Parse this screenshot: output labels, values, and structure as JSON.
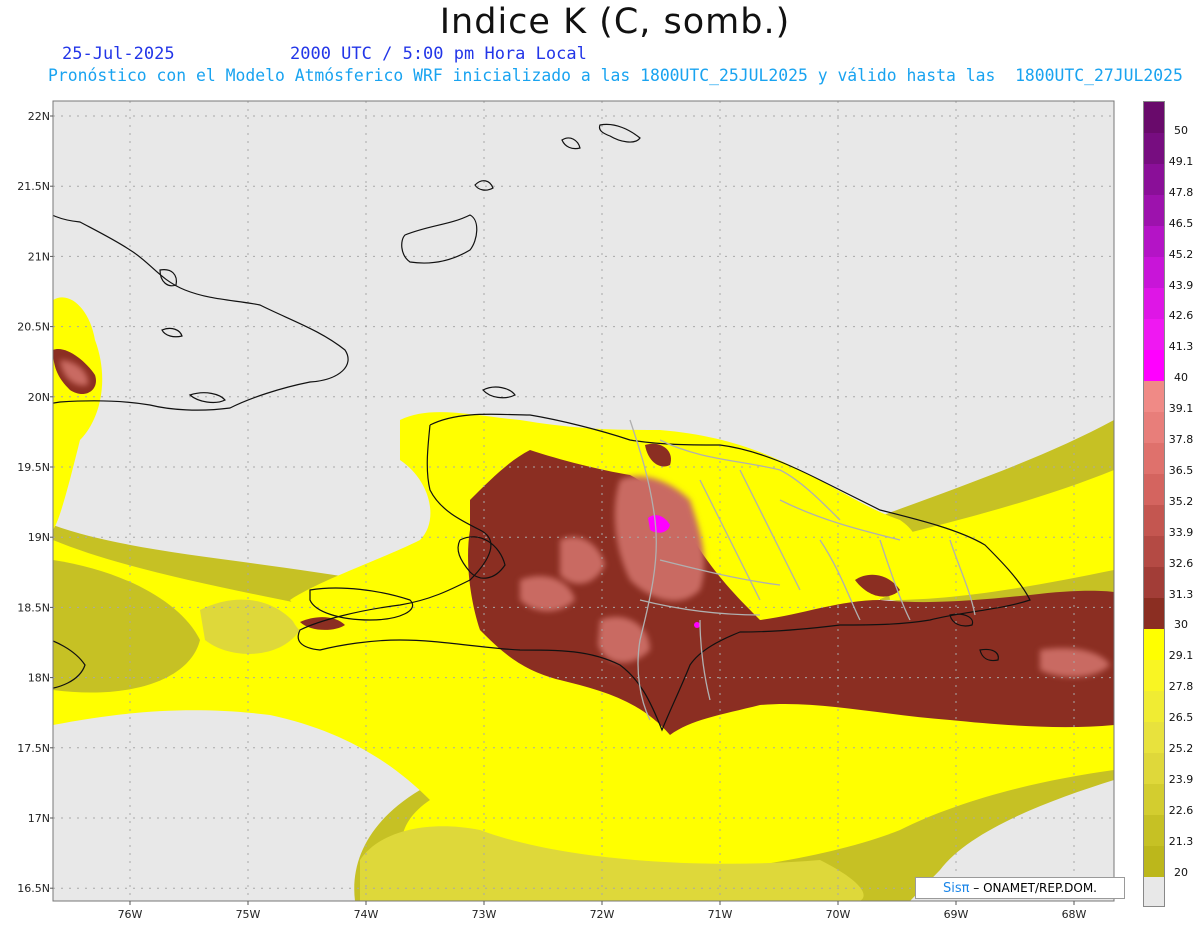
{
  "title": "Indice K (C, somb.)",
  "date_label": "25-Jul-2025",
  "time_label": "2000 UTC / 5:00 pm Hora Local",
  "description": "Pronóstico con el Modelo Atmósferico WRF inicializado a las 1800UTC_25JUL2025 y válido hasta las  1800UTC_27JUL2025",
  "credit": {
    "brand": "Sisπ",
    "org": "– ONAMET/REP.DOM."
  },
  "lat_labels": [
    "22N",
    "21.5N",
    "21N",
    "20.5N",
    "20N",
    "19.5N",
    "19N",
    "18.5N",
    "18N",
    "17.5N",
    "17N",
    "16.5N"
  ],
  "lon_labels": [
    "76W",
    "75W",
    "74W",
    "73W",
    "72W",
    "71W",
    "70W",
    "69W",
    "68W"
  ],
  "colorbar": {
    "labels": [
      "50",
      "49.1",
      "47.8",
      "46.5",
      "45.2",
      "43.9",
      "42.6",
      "41.3",
      "40",
      "39.1",
      "37.8",
      "36.5",
      "35.2",
      "33.9",
      "32.6",
      "31.3",
      "30",
      "29.1",
      "27.8",
      "26.5",
      "25.2",
      "23.9",
      "22.6",
      "21.3",
      "20"
    ],
    "colors": [
      "#690a6b",
      "#770d80",
      "#8a0f98",
      "#9d12ad",
      "#b414c6",
      "#c815d8",
      "#de16e6",
      "#ef18f2",
      "#ff00ff",
      "#f08a86",
      "#e87e7a",
      "#df716c",
      "#d4645f",
      "#c45650",
      "#b44a44",
      "#a23d37",
      "#8b2e22",
      "#ffff00",
      "#f9f523",
      "#f0ec33",
      "#e8e23d",
      "#dfd83a",
      "#d3cd2f",
      "#c6c124",
      "#bcb71b"
    ],
    "bottom_color": "#e8e8e8"
  },
  "map": {
    "background": "#e8e8e8",
    "colors": {
      "low": "#ffff00",
      "mid": "#ded83a",
      "olive": "#c6c124",
      "brown": "#8b2e22",
      "rose": "#c96a62",
      "magenta": "#ff00ff",
      "coast": "#111111",
      "border": "#b0b0b0"
    }
  }
}
